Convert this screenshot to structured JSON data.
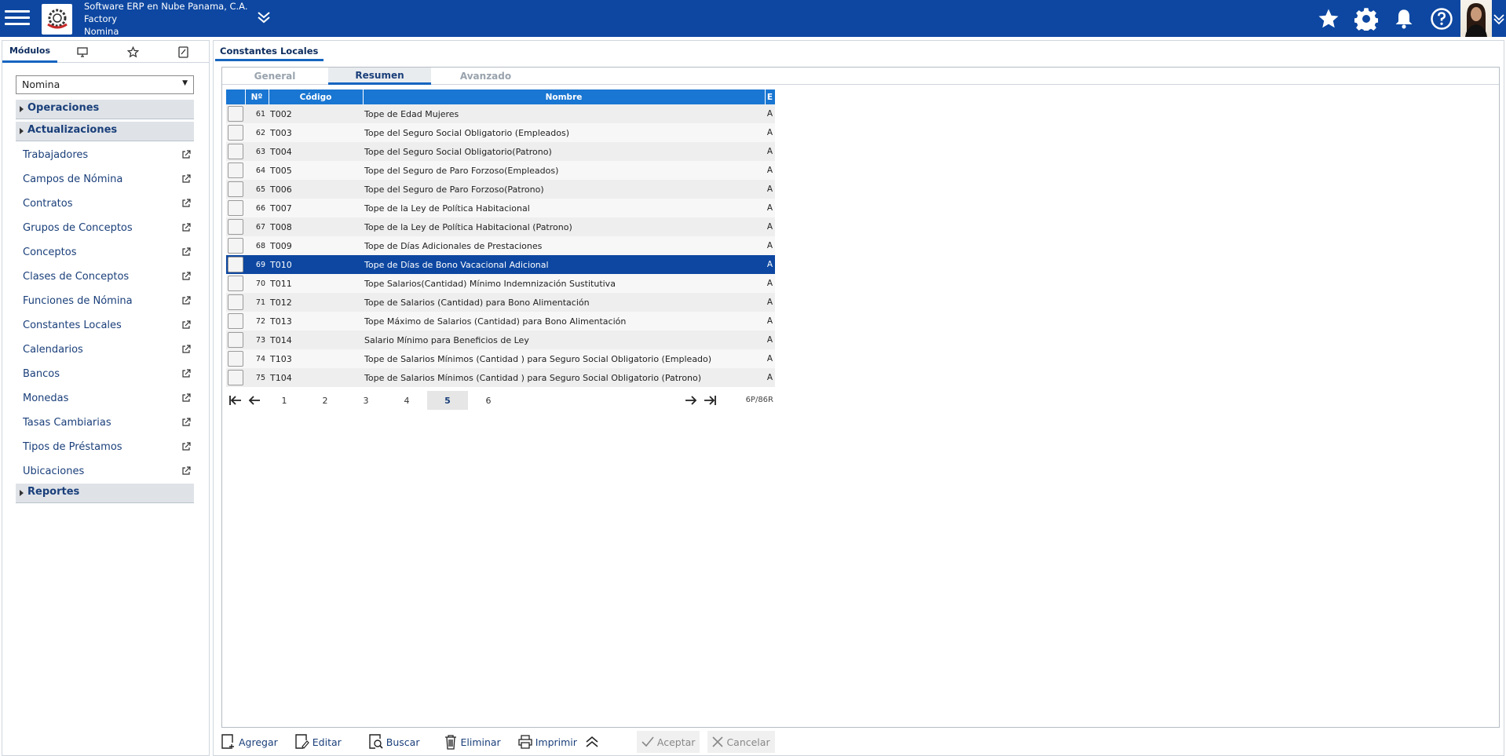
{
  "header": {
    "company_line1": "Software ERP en Nube Panama, C.A.",
    "company_line2": "Factory",
    "company_line3": "Nomina",
    "icons": [
      "menu-icon",
      "chevron-double-down-icon",
      "star-icon",
      "gear-icon",
      "bell-icon",
      "help-icon",
      "avatar",
      "chevron-down-icon"
    ],
    "bar_color": "#0d47a1"
  },
  "sidebar": {
    "tab_modules": "Módulos",
    "module_selected": "Nomina",
    "section_operaciones": "Operaciones",
    "section_actualizaciones": "Actualizaciones",
    "section_reportes": "Reportes",
    "items": [
      {
        "label": "Trabajadores"
      },
      {
        "label": "Campos de Nómina"
      },
      {
        "label": "Contratos"
      },
      {
        "label": "Grupos de Conceptos"
      },
      {
        "label": "Conceptos"
      },
      {
        "label": "Clases de Conceptos"
      },
      {
        "label": "Funciones de Nómina"
      },
      {
        "label": "Constantes Locales"
      },
      {
        "label": "Calendarios"
      },
      {
        "label": "Bancos"
      },
      {
        "label": "Monedas"
      },
      {
        "label": "Tasas Cambiarias"
      },
      {
        "label": "Tipos de Préstamos"
      },
      {
        "label": "Ubicaciones"
      }
    ]
  },
  "main": {
    "tab_title": "Constantes Locales",
    "subtabs": {
      "general": "General",
      "resumen": "Resumen",
      "avanzado": "Avanzado"
    },
    "columns": {
      "num": "Nº",
      "code": "Código",
      "name": "Nombre",
      "state": "E"
    },
    "rows": [
      {
        "num": "61",
        "code": "T002",
        "name": "Tope de Edad Mujeres",
        "state": "A"
      },
      {
        "num": "62",
        "code": "T003",
        "name": "Tope del Seguro Social Obligatorio (Empleados)",
        "state": "A"
      },
      {
        "num": "63",
        "code": "T004",
        "name": "Tope del Seguro Social Obligatorio(Patrono)",
        "state": "A"
      },
      {
        "num": "64",
        "code": "T005",
        "name": "Tope del Seguro de Paro Forzoso(Empleados)",
        "state": "A"
      },
      {
        "num": "65",
        "code": "T006",
        "name": "Tope del Seguro de Paro Forzoso(Patrono)",
        "state": "A"
      },
      {
        "num": "66",
        "code": "T007",
        "name": "Tope de la Ley de Política Habitacional",
        "state": "A"
      },
      {
        "num": "67",
        "code": "T008",
        "name": "Tope de la Ley de Política Habitacional (Patrono)",
        "state": "A"
      },
      {
        "num": "68",
        "code": "T009",
        "name": "Tope de Días Adicionales de Prestaciones",
        "state": "A"
      },
      {
        "num": "69",
        "code": "T010",
        "name": "Tope de Días de Bono Vacacional Adicional",
        "state": "A"
      },
      {
        "num": "70",
        "code": "T011",
        "name": "Tope Salarios(Cantidad) Mínimo Indemnización Sustitutiva",
        "state": "A"
      },
      {
        "num": "71",
        "code": "T012",
        "name": "Tope de Salarios (Cantidad) para Bono Alimentación",
        "state": "A"
      },
      {
        "num": "72",
        "code": "T013",
        "name": "Tope Máximo de Salarios (Cantidad) para Bono Alimentación",
        "state": "A"
      },
      {
        "num": "73",
        "code": "T014",
        "name": "Salario Mínimo para Beneficios de Ley",
        "state": "A"
      },
      {
        "num": "74",
        "code": "T103",
        "name": "Tope de Salarios Mínimos (Cantidad ) para Seguro Social Obligatorio (Empleado)",
        "state": "A"
      },
      {
        "num": "75",
        "code": "T104",
        "name": "Tope de Salarios Mínimos (Cantidad ) para Seguro Social Obligatorio (Patrono)",
        "state": "A"
      }
    ],
    "selected_row": "69",
    "pager": {
      "pages": [
        "1",
        "2",
        "3",
        "4",
        "5",
        "6"
      ],
      "current_page": "5",
      "info": "6P/86R"
    }
  },
  "toolbar": {
    "add": "Agregar",
    "edit": "Editar",
    "search": "Buscar",
    "delete": "Eliminar",
    "print": "Imprimir",
    "accept": "Aceptar",
    "cancel": "Cancelar"
  }
}
